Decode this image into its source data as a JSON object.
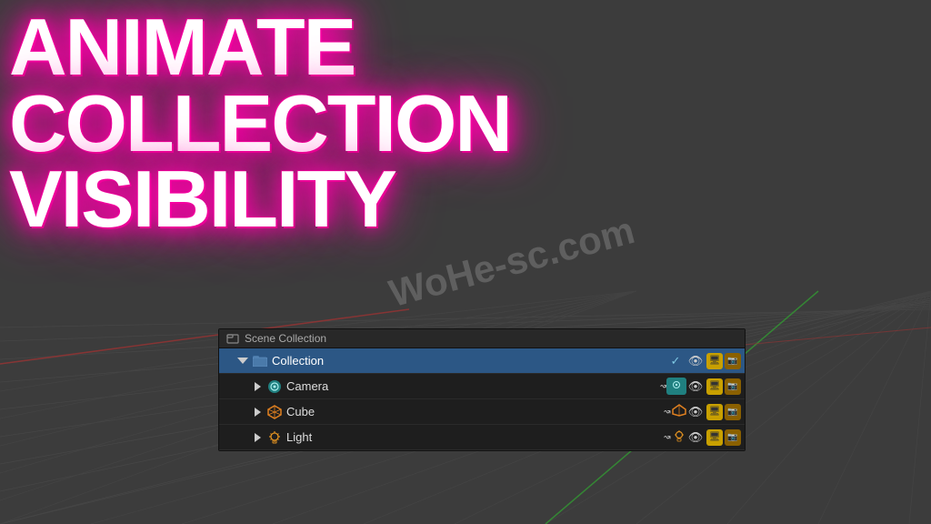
{
  "viewport": {
    "bg_color": "#3c3c3c"
  },
  "title": {
    "line1": "ANIMATE",
    "line2": "COLLECTION",
    "line3": "VISIBILITY"
  },
  "watermark": {
    "text": "WoHe-sc.com"
  },
  "outliner": {
    "scene_collection_label": "Scene Collection",
    "rows": [
      {
        "id": "collection",
        "label": "Collection",
        "indent": 0,
        "collapsed": false,
        "selected": true,
        "icon": "folder",
        "has_triangle": true,
        "triangle_down": true,
        "show_checkbox": true,
        "show_eye": true,
        "show_monitor": true,
        "show_camera": true
      },
      {
        "id": "camera",
        "label": "Camera",
        "indent": 1,
        "selected": false,
        "icon": "camera",
        "has_triangle": true,
        "triangle_down": false,
        "show_animate": true,
        "animate_icon": "camera",
        "show_eye": true,
        "show_monitor": true,
        "show_camera": true
      },
      {
        "id": "cube",
        "label": "Cube",
        "indent": 1,
        "selected": false,
        "icon": "cube",
        "has_triangle": true,
        "triangle_down": false,
        "show_animate": true,
        "animate_icon": "cube",
        "show_eye": true,
        "show_monitor": true,
        "show_camera": true
      },
      {
        "id": "light",
        "label": "Light",
        "indent": 1,
        "selected": false,
        "icon": "light",
        "has_triangle": true,
        "triangle_down": false,
        "show_animate": true,
        "animate_icon": "light",
        "show_eye": true,
        "show_monitor": true,
        "show_camera": true
      }
    ]
  }
}
